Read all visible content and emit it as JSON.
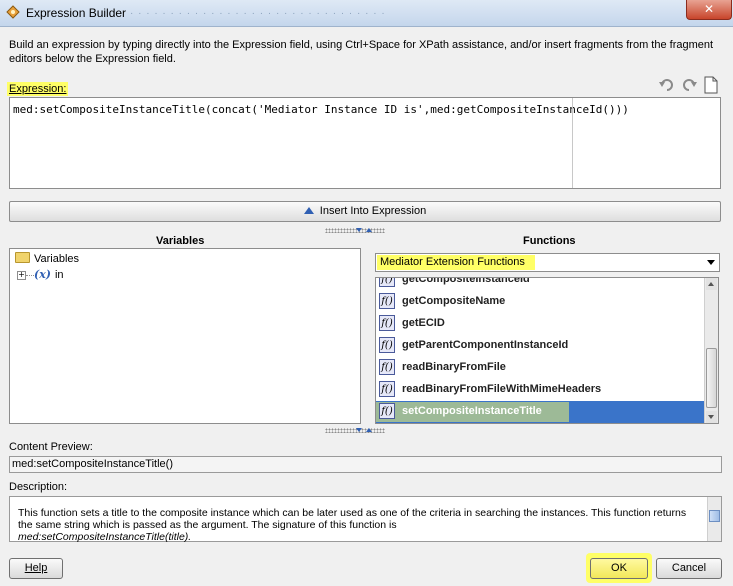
{
  "window": {
    "title": "Expression Builder",
    "close_glyph": "✕",
    "icon": "app-icon"
  },
  "intro_text": "Build an expression by typing directly into the Expression field, using Ctrl+Space for XPath assistance, and/or insert fragments from the fragment editors below the Expression field.",
  "expression": {
    "label": "Expression:",
    "value": "med:setCompositeInstanceTitle(concat('Mediator Instance ID is',med:getCompositeInstanceId()))",
    "tools": [
      "undo-icon",
      "redo-icon",
      "clear-icon"
    ]
  },
  "insert_button": {
    "label": "Insert Into Expression"
  },
  "variables": {
    "header": "Variables",
    "root": "Variables",
    "children": [
      "in"
    ]
  },
  "functions": {
    "header": "Functions",
    "category": "Mediator Extension Functions",
    "items": [
      "getCompositeInstanceId",
      "getCompositeName",
      "getECID",
      "getParentComponentInstanceId",
      "readBinaryFromFile",
      "readBinaryFromFileWithMimeHeaders",
      "setCompositeInstanceTitle"
    ],
    "selected": "setCompositeInstanceTitle",
    "icon_glyph": "f()"
  },
  "content_preview": {
    "label": "Content Preview:",
    "value": "med:setCompositeInstanceTitle()"
  },
  "description": {
    "label": "Description:",
    "text": "This function sets a title to the composite instance which can be later used as one of the criteria in searching the instances. This function returns the same string which is passed as the argument. The signature of this function is",
    "signature": "med:setCompositeInstanceTitle(title)."
  },
  "buttons": {
    "help": "Help",
    "ok": "OK",
    "cancel": "Cancel"
  },
  "colors": {
    "highlight": "#ffff66",
    "selection": "#3a74c9",
    "accent": "#2f5fb3"
  }
}
